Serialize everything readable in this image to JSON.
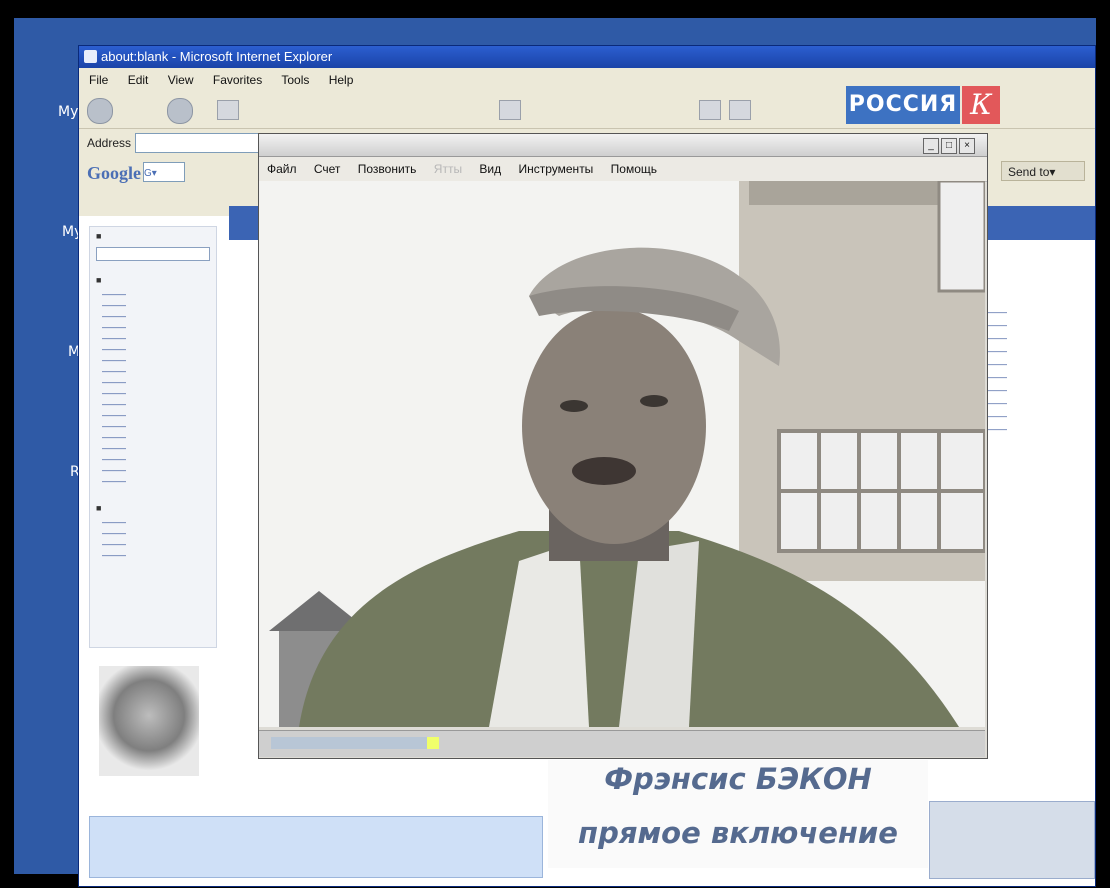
{
  "desktop": {
    "icons": [
      {
        "label": "My"
      },
      {
        "label": "My"
      },
      {
        "label": "M"
      },
      {
        "label": "R"
      }
    ]
  },
  "ie": {
    "title": "about:blank - Microsoft Internet Explorer",
    "menu": [
      "File",
      "Edit",
      "View",
      "Favorites",
      "Tools",
      "Help"
    ],
    "address_label": "Address",
    "google_label": "Google",
    "google_search_icon": "G▾",
    "send_to": "Send to▾"
  },
  "player": {
    "menu": [
      "Файл",
      "Счет",
      "Позвонить",
      "Ятты",
      "Вид",
      "Инструменты",
      "Помощь"
    ],
    "progress_fraction": 0.24
  },
  "channel": {
    "name": "РОССИЯ",
    "mark": "К"
  },
  "captions": {
    "line1": "Фрэнсис БЭКОН",
    "line2": "прямое включение"
  },
  "colors": {
    "desktop": "#2f5aa6",
    "caption": "#556a8f",
    "logo_blue": "#3d72c2",
    "logo_red": "#e2585a"
  }
}
